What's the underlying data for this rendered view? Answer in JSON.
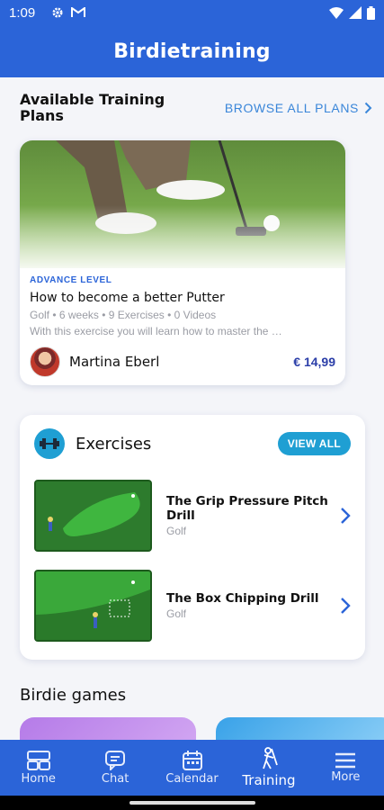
{
  "status_bar": {
    "time": "1:09"
  },
  "app_bar": {
    "title": "Birdietraining"
  },
  "plans_section": {
    "title": "Available Training Plans",
    "browse_label": "BROWSE ALL PLANS",
    "card": {
      "level": "ADVANCE LEVEL",
      "title": "How to become a better Putter",
      "meta": "Golf • 6 weeks • 9 Exercises • 0 Videos",
      "description": "With this exercise you will learn how to master the …",
      "author": "Martina Eberl",
      "price": "€ 14,99"
    }
  },
  "exercises_section": {
    "title": "Exercises",
    "view_all_label": "VIEW ALL",
    "items": [
      {
        "name": "The Grip Pressure Pitch Drill",
        "sport": "Golf"
      },
      {
        "name": "The Box Chipping Drill",
        "sport": "Golf"
      }
    ]
  },
  "games_section": {
    "title": "Birdie games"
  },
  "bottom_nav": {
    "items": [
      {
        "label": "Home",
        "icon": "home-icon"
      },
      {
        "label": "Chat",
        "icon": "chat-icon"
      },
      {
        "label": "Calendar",
        "icon": "calendar-icon"
      },
      {
        "label": "Training",
        "icon": "golfer-icon"
      },
      {
        "label": "More",
        "icon": "menu-icon"
      }
    ],
    "active": "Training"
  },
  "colors": {
    "primary": "#2b64d8",
    "accent": "#1f9fd3",
    "link": "#3a86d9",
    "price": "#2b3ea8"
  }
}
